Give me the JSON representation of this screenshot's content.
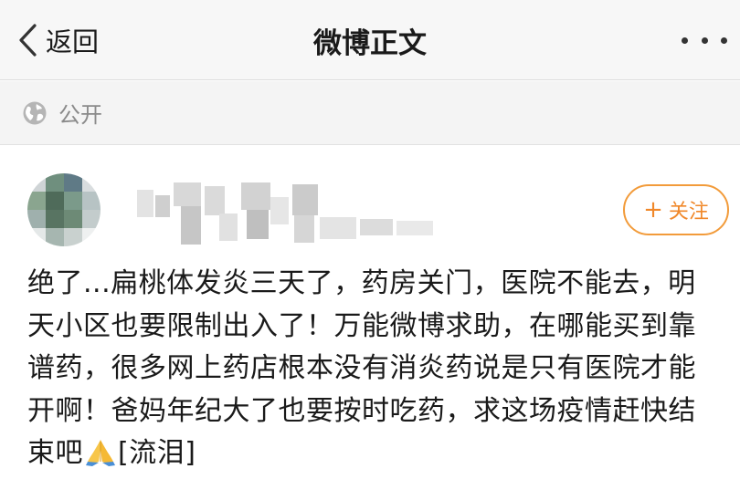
{
  "header": {
    "back_label": "返回",
    "title": "微博正文"
  },
  "visibility": {
    "label": "公开",
    "icon": "globe-icon"
  },
  "post": {
    "follow_label": "关注",
    "follow_prefix": "+",
    "text": "绝了...扁桃体发炎三天了，药房关门，医院不能去，明天小区也要限制出入了！万能微博求助，在哪能买到靠谱药，很多网上药店根本没有消炎药说是只有医院才能开啊！爸妈年纪大了也要按时吃药，求这场疫情赶快结束吧",
    "text_suffix": "[流泪]",
    "emoji_icon": "praying-hands-icon"
  },
  "colors": {
    "accent": "#f0882a",
    "nav_bg": "#f7f7f7",
    "sub_bg": "#f4f4f4"
  }
}
